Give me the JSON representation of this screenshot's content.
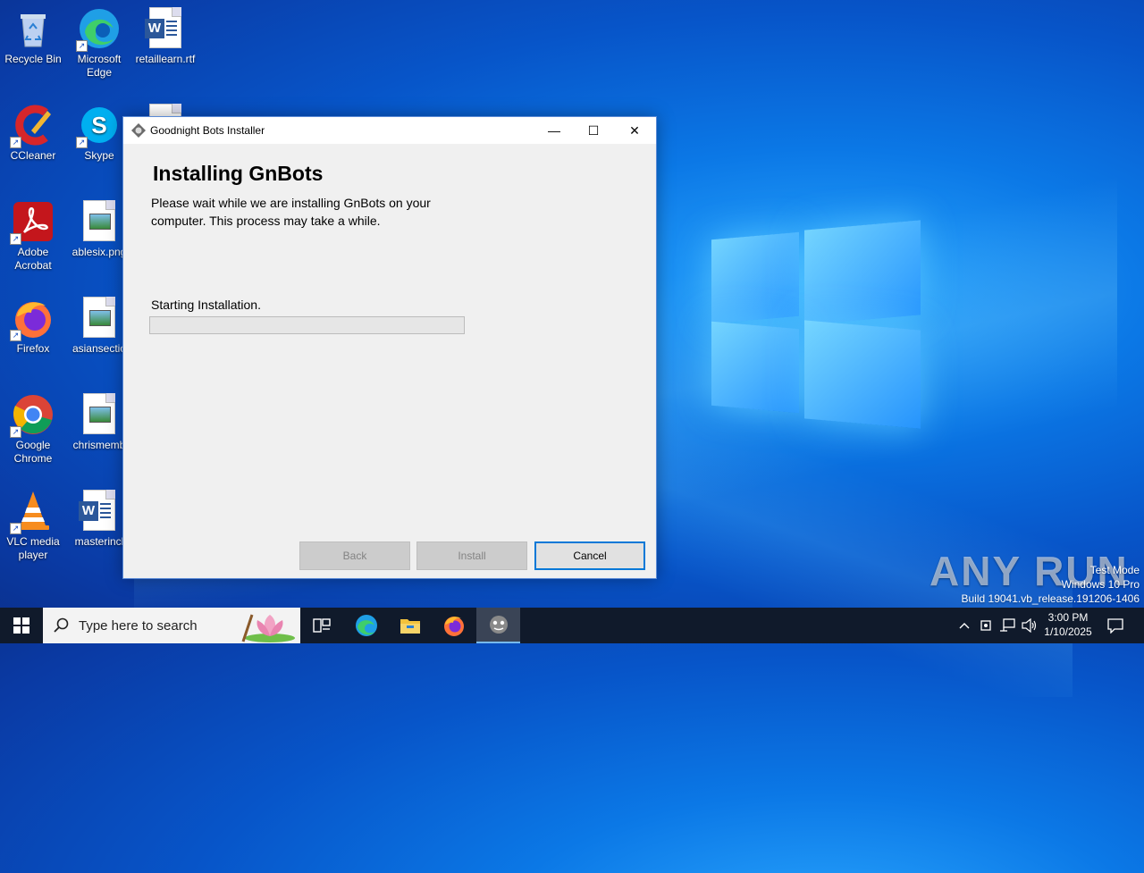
{
  "desktop": {
    "icons": [
      {
        "label": "Recycle Bin"
      },
      {
        "label": "Microsoft Edge"
      },
      {
        "label": "retaillearn.rtf"
      },
      {
        "label": "CCleaner"
      },
      {
        "label": "Skype"
      },
      {
        "label": "Adobe Acrobat"
      },
      {
        "label": "ablesix.png"
      },
      {
        "label": "Firefox"
      },
      {
        "label": "asiansectio"
      },
      {
        "label": "Google Chrome"
      },
      {
        "label": "chrismemb"
      },
      {
        "label": "VLC media player"
      },
      {
        "label": "masterincl"
      }
    ]
  },
  "dialog": {
    "title": "Goodnight Bots Installer",
    "heading": "Installing GnBots",
    "description": "Please wait while we are installing GnBots on your computer. This process may take a while.",
    "status": "Starting Installation.",
    "progress_percent": 0,
    "buttons": {
      "back": "Back",
      "install": "Install",
      "cancel": "Cancel"
    },
    "controls": {
      "minimize": "—",
      "maximize": "☐",
      "close": "✕"
    }
  },
  "watermark": {
    "brand": "ANY RUN",
    "lines": [
      "Test Mode",
      "Windows 10 Pro",
      "Build 19041.vb_release.191206-1406"
    ]
  },
  "taskbar": {
    "search_placeholder": "Type here to search",
    "time": "3:00 PM",
    "date": "1/10/2025"
  },
  "colors": {
    "accent": "#0078d7",
    "taskbar": "#101a2b"
  }
}
